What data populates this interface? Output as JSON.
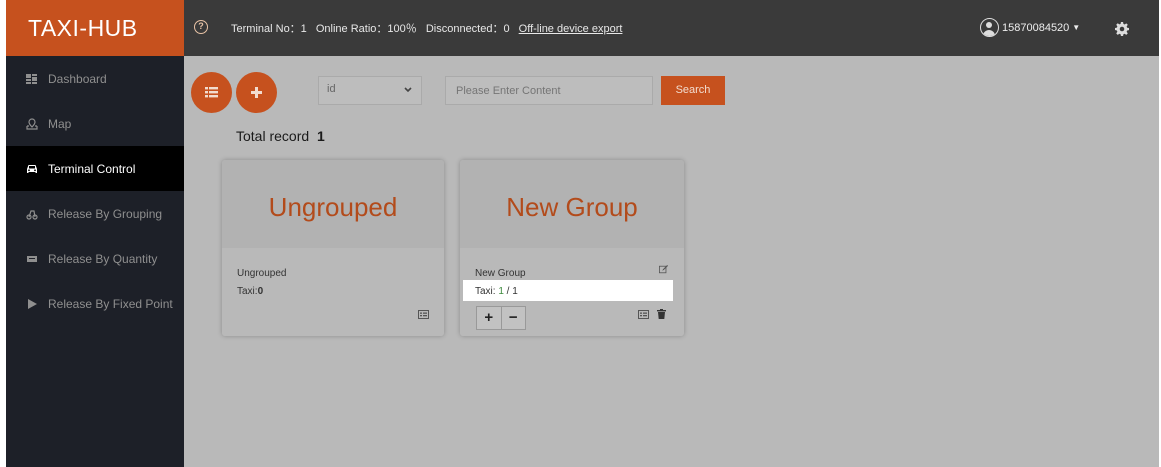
{
  "brand": "TAXI-HUB",
  "status": {
    "terminal": "Terminal No：1",
    "online": "Online Ratio：100％",
    "disconnected": "Disconnected：0",
    "export_link": "Off-line device export"
  },
  "user": {
    "phone": "15870084520"
  },
  "sidebar": {
    "items": [
      {
        "label": "Dashboard",
        "icon": "dashboard-icon"
      },
      {
        "label": "Map",
        "icon": "map-icon"
      },
      {
        "label": "Terminal Control",
        "icon": "car-icon",
        "active": true
      },
      {
        "label": "Release By Grouping",
        "icon": "grouping-icon"
      },
      {
        "label": "Release By Quantity",
        "icon": "quantity-icon"
      },
      {
        "label": "Release By Fixed Point",
        "icon": "play-icon"
      }
    ]
  },
  "toolbar": {
    "select_value": "id",
    "search_placeholder": "Please Enter Content",
    "search_label": "Search"
  },
  "total": {
    "label": "Total record",
    "value": "1"
  },
  "groups": [
    {
      "title": "Ungrouped",
      "name": "Ungrouped",
      "taxi_label": "Taxi:",
      "taxi_value": "0"
    },
    {
      "title": "New Group",
      "name": "New Group",
      "taxi_label": "Taxi:",
      "taxi_online": "1",
      "taxi_sep": " / ",
      "taxi_total": "1"
    }
  ],
  "colors": {
    "accent": "#c6511e",
    "sidebar": "#1d2028",
    "topbar": "#3a3a3a"
  }
}
